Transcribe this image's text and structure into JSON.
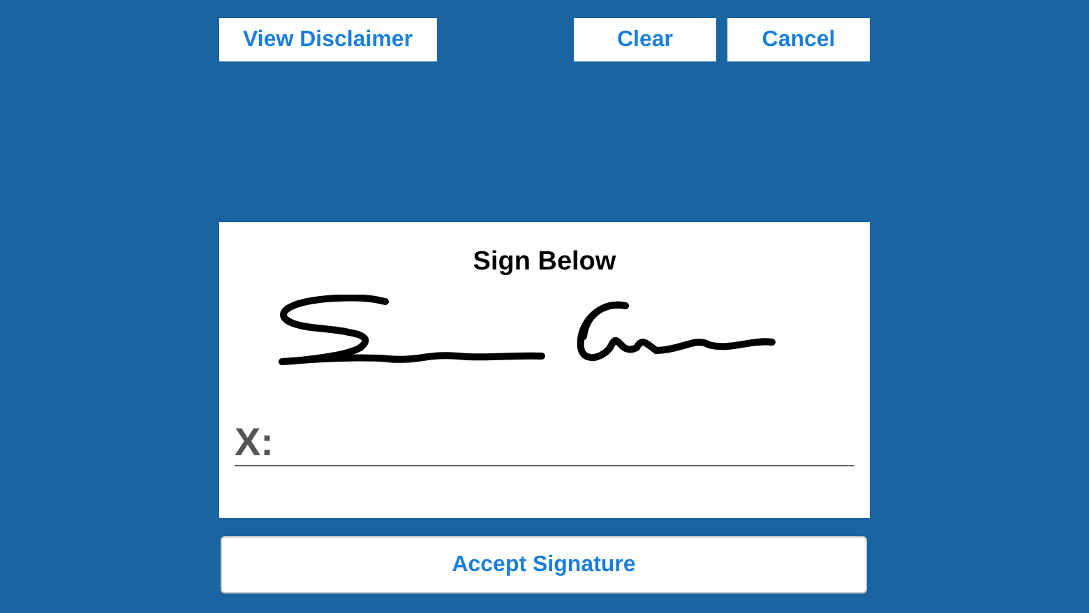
{
  "toolbar": {
    "buttons": [
      {
        "label": "View Disclaimer",
        "kind": "left"
      },
      {
        "label": "Clear",
        "kind": "right"
      },
      {
        "label": "Cancel",
        "kind": "right"
      }
    ]
  },
  "signature_pad": {
    "title": "Sign Below",
    "line_label": "X:"
  },
  "accept_button": {
    "label": "Accept Signature"
  }
}
